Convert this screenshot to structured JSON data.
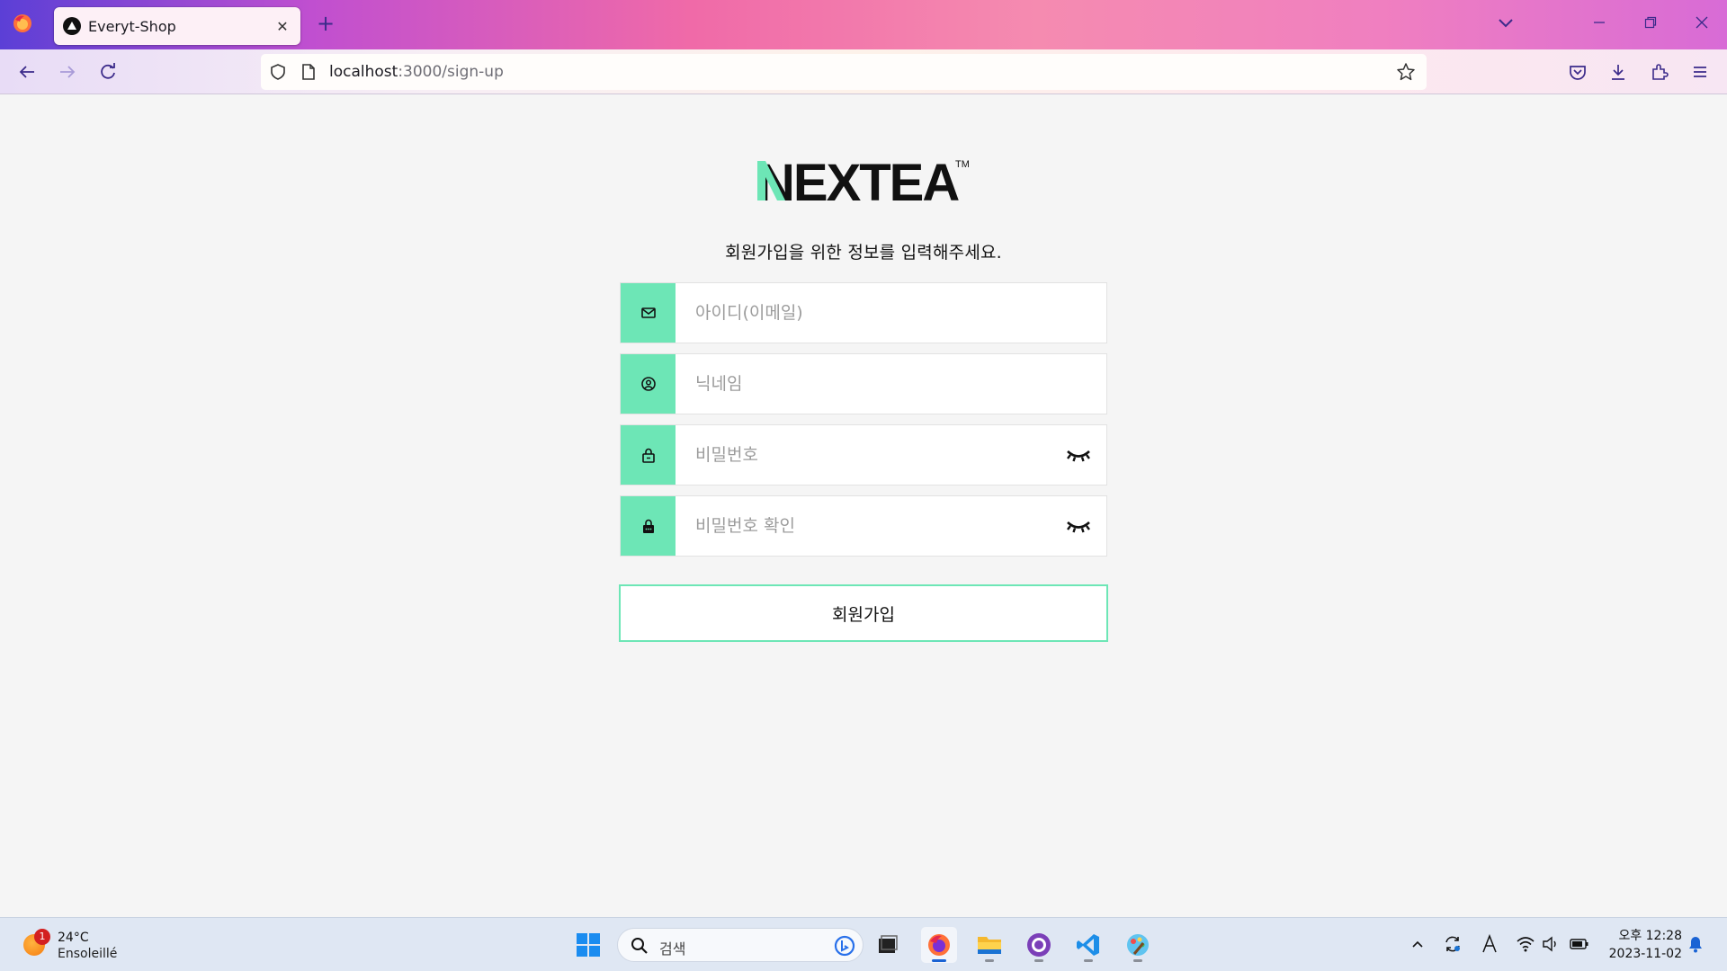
{
  "browser": {
    "tab_title": "Everyt-Shop",
    "url_host": "localhost",
    "url_path": ":3000/sign-up"
  },
  "page": {
    "logo_text": "NEXTEA",
    "logo_mark": "TM",
    "subtitle": "회원가입을 위한 정보를 입력해주세요.",
    "fields": [
      {
        "icon": "mail-icon",
        "placeholder": "아이디(이메일)"
      },
      {
        "icon": "user-circle-icon",
        "placeholder": "닉네임"
      },
      {
        "icon": "lock-outline-icon",
        "placeholder": "비밀번호"
      },
      {
        "icon": "lock-filled-icon",
        "placeholder": "비밀번호 확인"
      }
    ],
    "submit_label": "회원가입",
    "accent_color": "#6de6b6"
  },
  "taskbar": {
    "weather_temp": "24°C",
    "weather_desc": "Ensoleillé",
    "weather_badge": "1",
    "search_placeholder": "검색",
    "clock_time": "오후 12:28",
    "clock_date": "2023-11-02"
  }
}
